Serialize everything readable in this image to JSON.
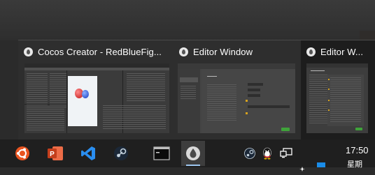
{
  "previews": [
    {
      "title": "Cocos Creator - RedBlueFig...",
      "app_icon": "cocos-creator-icon",
      "active": false
    },
    {
      "title": "Editor Window",
      "app_icon": "cocos-creator-icon",
      "active": false
    },
    {
      "title": "Editor W...",
      "app_icon": "cocos-creator-icon",
      "active": true
    }
  ],
  "taskbar": {
    "apps": [
      "ubuntu-icon",
      "powerpoint-icon",
      "vscode-icon",
      "steam-icon",
      "terminal-icon",
      "cocos-creator-icon"
    ]
  },
  "tray": {
    "icons": [
      "steam-tray-icon",
      "qq-tray-icon",
      "network-icon"
    ],
    "time": "17:50",
    "date_fragment": "星期"
  },
  "colors": {
    "taskbar_bg": "#1f1f1f",
    "preview_bg": "#2e2e2e",
    "active_underline": "#9ec7f0",
    "powerpoint_red": "#c43e1c",
    "vscode_blue": "#2a8ef0"
  }
}
